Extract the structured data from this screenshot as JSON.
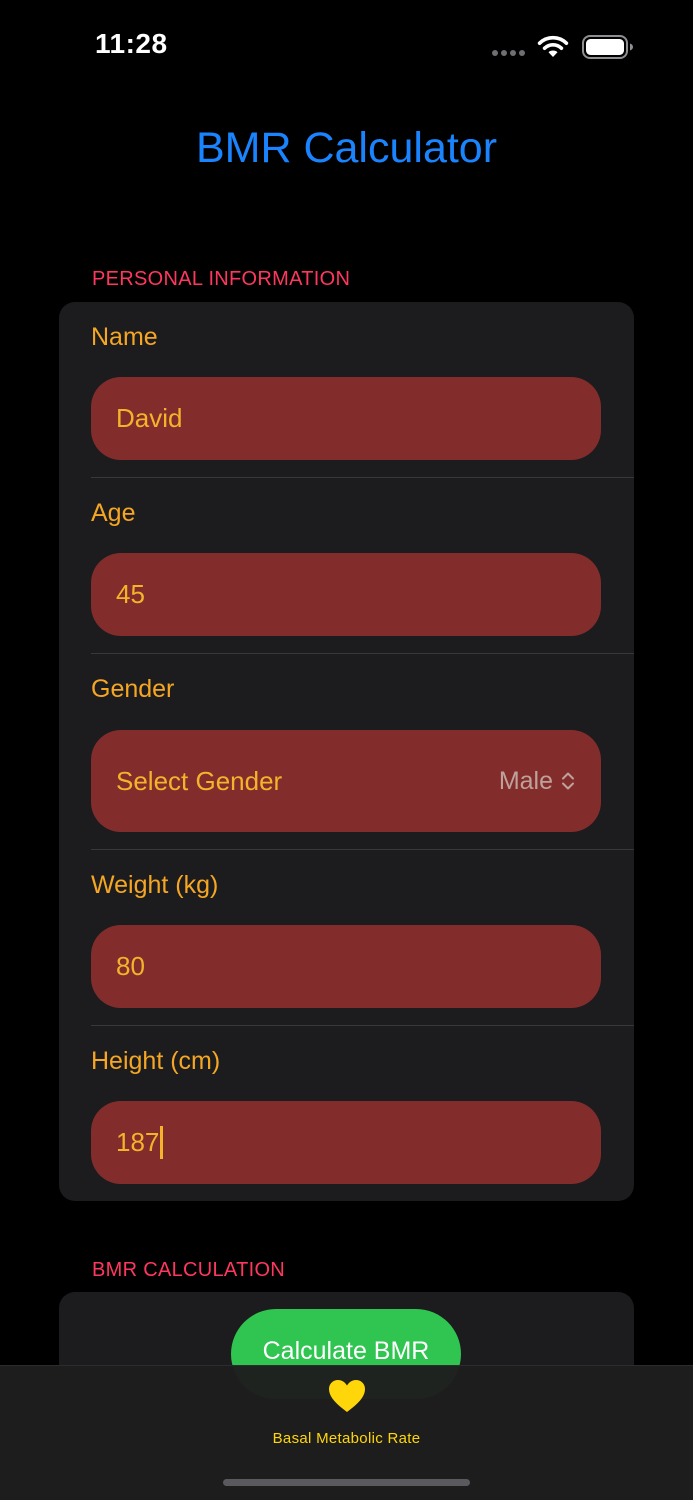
{
  "status_bar": {
    "time": "11:28"
  },
  "nav": {
    "title": "BMR Calculator"
  },
  "personal_section": {
    "header": "PERSONAL INFORMATION",
    "fields": {
      "name": {
        "label": "Name",
        "value": "David"
      },
      "age": {
        "label": "Age",
        "value": "45"
      },
      "gender": {
        "label": "Gender",
        "picker_label": "Select Gender",
        "selected": "Male"
      },
      "weight": {
        "label": "Weight (kg)",
        "value": "80"
      },
      "height": {
        "label": "Height (cm)",
        "value": "187"
      }
    }
  },
  "calculation_section": {
    "header": "BMR CALCULATION",
    "button_label": "Calculate BMR"
  },
  "tab_bar": {
    "items": [
      {
        "label": "Basal Metabolic Rate",
        "icon": "heart-icon",
        "selected": true
      }
    ]
  },
  "colors": {
    "title": "#1a84ff",
    "section_header": "#ff375f",
    "label": "#f5a623",
    "field_background": "#822d2c",
    "button": "#30c451",
    "tab_active": "#ffd60a"
  }
}
